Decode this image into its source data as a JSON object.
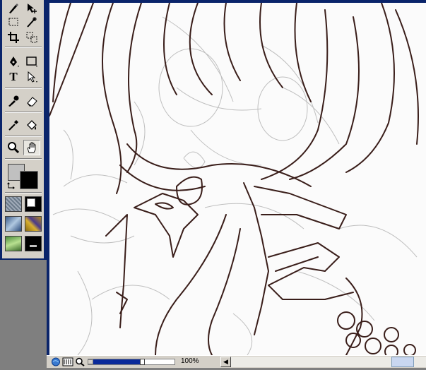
{
  "toolbox": {
    "tools": [
      {
        "name": "brush-tool-icon"
      },
      {
        "name": "move-tool-icon"
      },
      {
        "name": "marquee-tool-icon"
      },
      {
        "name": "magic-wand-tool-icon"
      },
      {
        "name": "crop-tool-icon"
      },
      {
        "name": "slice-tool-icon"
      },
      {
        "name": "pen-tool-icon"
      },
      {
        "name": "rectangle-tool-icon"
      },
      {
        "name": "text-tool-icon"
      },
      {
        "name": "selection-arrow-tool-icon"
      },
      {
        "name": "dropper-tool-icon"
      },
      {
        "name": "eraser-tool-icon"
      },
      {
        "name": "eyedropper-tool-icon"
      },
      {
        "name": "paint-bucket-tool-icon"
      },
      {
        "name": "zoom-tool-icon"
      },
      {
        "name": "hand-tool-icon",
        "active": true
      }
    ],
    "text_tool_glyph": "T",
    "foreground_color": "#c0c0c0",
    "background_color": "#000000"
  },
  "statusbar": {
    "zoom_label": "100%",
    "zoom_level": 0.62
  },
  "colors": {
    "frame": "#0a246a",
    "panel": "#d4d0c8",
    "line_art": "#3a1e1a"
  }
}
